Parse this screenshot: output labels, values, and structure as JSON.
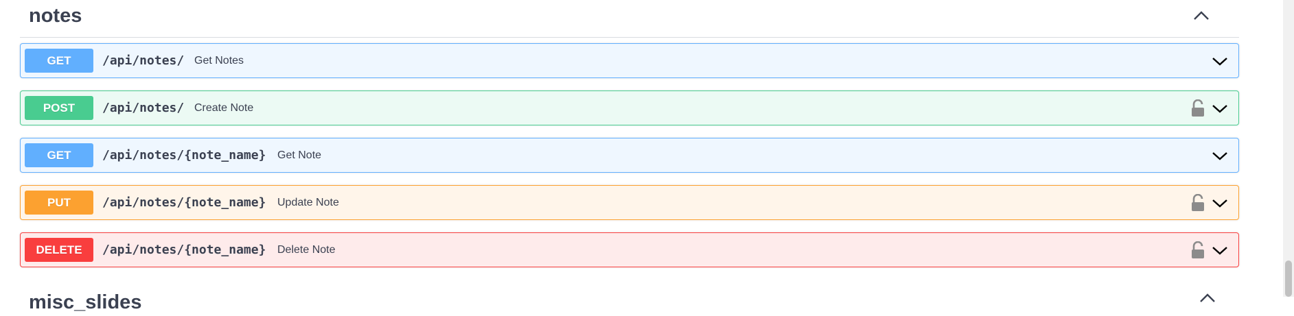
{
  "section": {
    "title": "notes"
  },
  "operations": [
    {
      "method": "GET",
      "path": "/api/notes/",
      "summary": "Get Notes",
      "locked": false,
      "color": "#61affe"
    },
    {
      "method": "POST",
      "path": "/api/notes/",
      "summary": "Create Note",
      "locked": true,
      "color": "#49cc90"
    },
    {
      "method": "GET",
      "path": "/api/notes/{note_name}",
      "summary": "Get Note",
      "locked": false,
      "color": "#61affe"
    },
    {
      "method": "PUT",
      "path": "/api/notes/{note_name}",
      "summary": "Update Note",
      "locked": true,
      "color": "#fca130"
    },
    {
      "method": "DELETE",
      "path": "/api/notes/{note_name}",
      "summary": "Delete Note",
      "locked": true,
      "color": "#f93e3e"
    }
  ],
  "icons": {
    "collapse": "chevron-up-icon",
    "expand": "chevron-down-icon",
    "lock": "unlocked-padlock-icon"
  },
  "next_section": {
    "title": "misc_slides"
  }
}
